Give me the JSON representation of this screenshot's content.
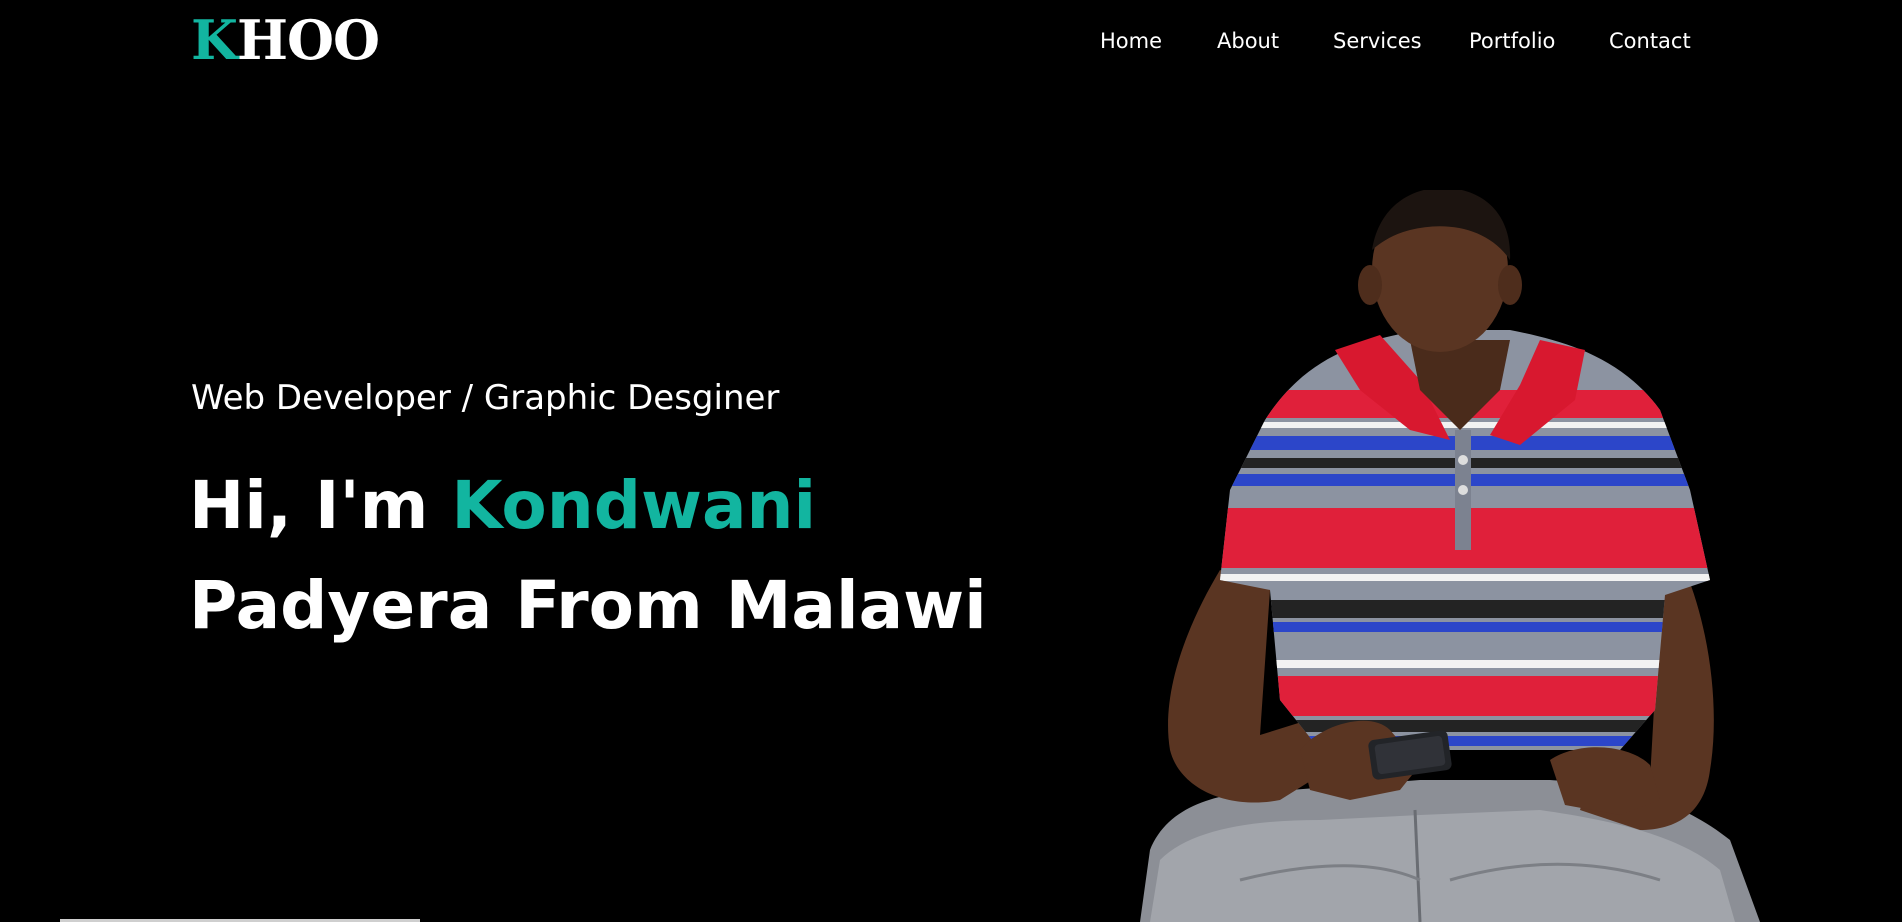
{
  "header": {
    "logo": {
      "accent_letter": "K",
      "rest": "HOO"
    },
    "nav": [
      {
        "label": "Home"
      },
      {
        "label": "About"
      },
      {
        "label": "Services"
      },
      {
        "label": "Portfolio"
      },
      {
        "label": "Contact"
      }
    ]
  },
  "hero": {
    "subtitle": "Web Developer / Graphic Desginer",
    "title_prefix": "Hi, I'm ",
    "title_name": "Kondwani",
    "title_line2": "Padyera From Malawi"
  },
  "colors": {
    "background": "#000000",
    "accent": "#12b5a0",
    "text": "#ffffff"
  },
  "icons": {
    "portrait": "person-portrait-image"
  }
}
